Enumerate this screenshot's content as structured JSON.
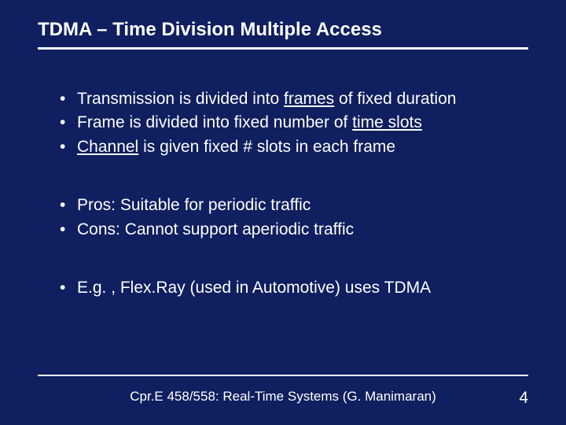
{
  "title": "TDMA – Time Division Multiple Access",
  "group1": {
    "b0": {
      "pre": "Transmission is divided into ",
      "u": "frames",
      "post": " of fixed duration"
    },
    "b1": {
      "pre": "Frame is divided into fixed number of ",
      "u": "time slots",
      "post": ""
    },
    "b2": {
      "preU": "Channel",
      "post": " is given fixed # slots in each frame"
    }
  },
  "group2": {
    "b0": "Pros: Suitable for periodic traffic",
    "b1": "Cons: Cannot support aperiodic traffic"
  },
  "group3": {
    "b0": "E.g. , Flex.Ray (used in Automotive) uses TDMA"
  },
  "footer": {
    "text": "Cpr.E 458/558: Real-Time Systems (G. Manimaran)",
    "page": "4"
  }
}
